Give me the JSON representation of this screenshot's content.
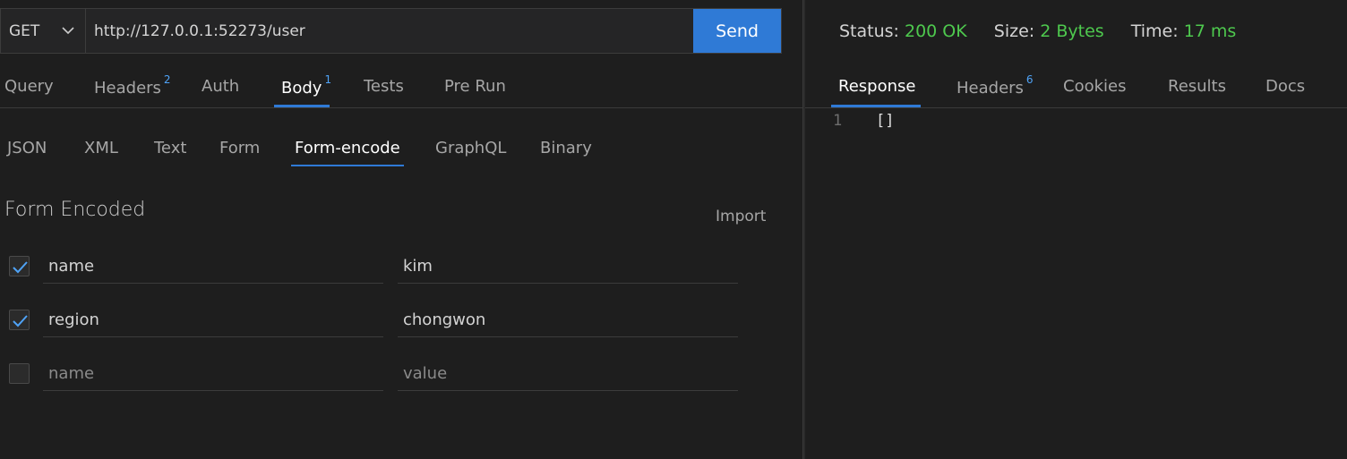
{
  "request": {
    "method": "GET",
    "url": "http://127.0.0.1:52273/user",
    "send_label": "Send"
  },
  "request_tabs": [
    {
      "label": "Query",
      "badge": ""
    },
    {
      "label": "Headers",
      "badge": "2"
    },
    {
      "label": "Auth",
      "badge": ""
    },
    {
      "label": "Body",
      "badge": "1"
    },
    {
      "label": "Tests",
      "badge": ""
    },
    {
      "label": "Pre Run",
      "badge": ""
    }
  ],
  "body_tabs": [
    "JSON",
    "XML",
    "Text",
    "Form",
    "Form-encode",
    "GraphQL",
    "Binary"
  ],
  "form": {
    "title": "Form Encoded",
    "import_label": "Import",
    "rows": [
      {
        "checked": true,
        "key": "name",
        "value": "kim"
      },
      {
        "checked": true,
        "key": "region",
        "value": "chongwon"
      }
    ],
    "placeholder": {
      "key": "name",
      "value": "value"
    }
  },
  "response": {
    "status_label": "Status:",
    "status_value": "200 OK",
    "size_label": "Size:",
    "size_value": "2 Bytes",
    "time_label": "Time:",
    "time_value": "17 ms",
    "tabs": [
      {
        "label": "Response",
        "badge": ""
      },
      {
        "label": "Headers",
        "badge": "6"
      },
      {
        "label": "Cookies",
        "badge": ""
      },
      {
        "label": "Results",
        "badge": ""
      },
      {
        "label": "Docs",
        "badge": ""
      }
    ],
    "line_number": "1",
    "body": "[]"
  },
  "colors": {
    "accent": "#2f7ad6",
    "status_ok": "#4ec94e",
    "background": "#1e1e1e"
  },
  "icons": {
    "method_dropdown": "chevron-down-icon",
    "checkbox_checked": "checkmark-icon"
  }
}
